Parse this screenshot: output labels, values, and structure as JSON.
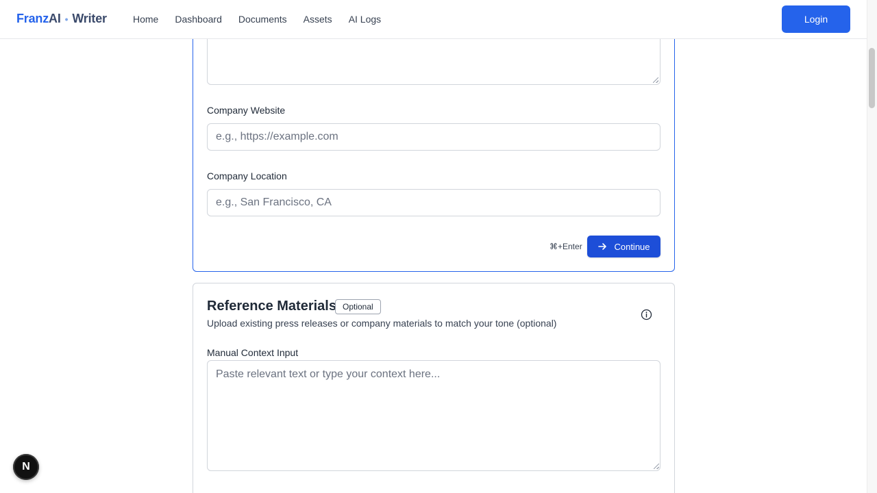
{
  "brand": {
    "part1": "Franz",
    "part2": "AI",
    "dot": "•",
    "part3": "Writer"
  },
  "nav": [
    "Home",
    "Dashboard",
    "Documents",
    "Assets",
    "AI Logs"
  ],
  "login_label": "Login",
  "company_form": {
    "website_label": "Company Website",
    "website_placeholder": "e.g., https://example.com",
    "location_label": "Company Location",
    "location_placeholder": "e.g., San Francisco, CA",
    "shortcut_hint": "⌘+Enter",
    "continue_label": "Continue"
  },
  "reference": {
    "title": "Reference Materials",
    "badge": "Optional",
    "subtitle": "Upload existing press releases or company materials to match your tone (optional)",
    "manual_label": "Manual Context Input",
    "manual_placeholder": "Paste relevant text or type your context here..."
  },
  "floating_badge": "N",
  "colors": {
    "accent": "#2563eb",
    "button_dark": "#1d4ed8"
  }
}
